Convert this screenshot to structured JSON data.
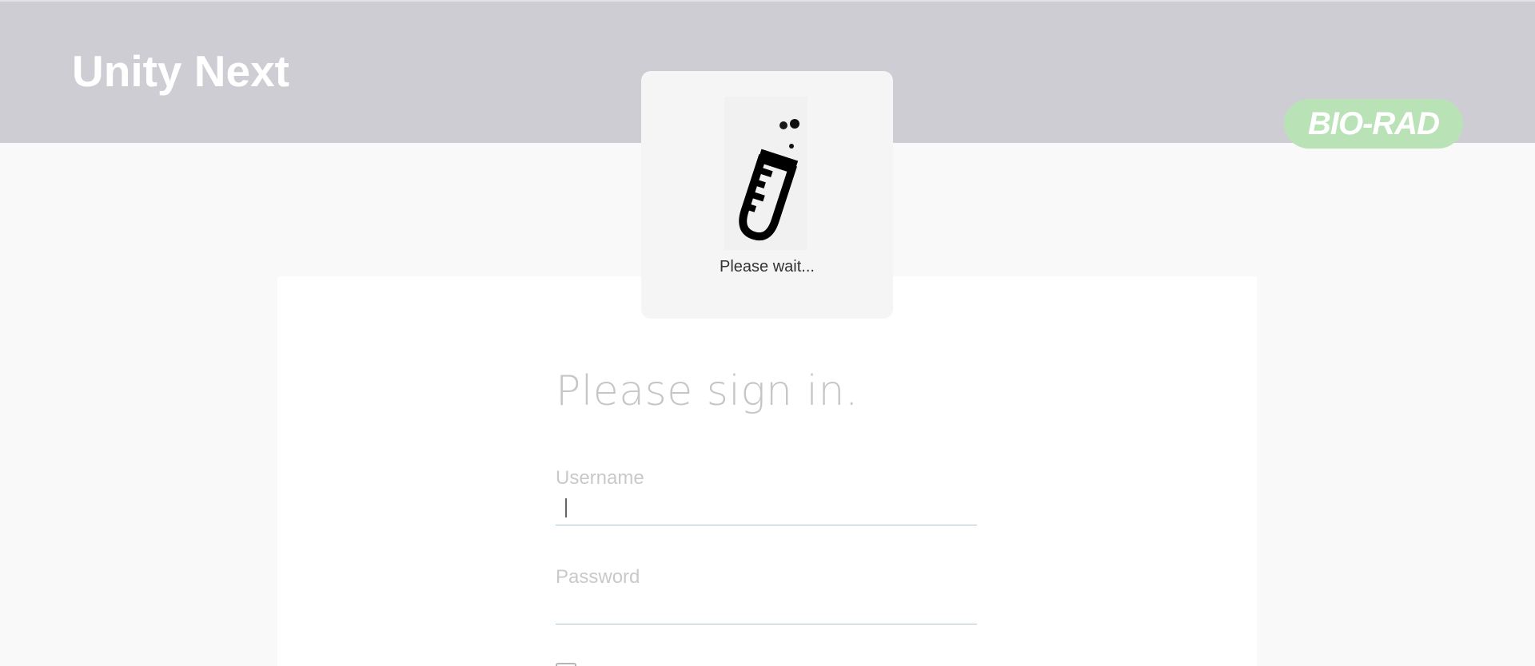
{
  "header": {
    "app_title": "Unity Next",
    "brand_logo_text": "BIO-RAD"
  },
  "loading": {
    "message": "Please wait..."
  },
  "signin": {
    "heading": "Please sign in.",
    "username_label": "Username",
    "username_value": "",
    "password_label": "Password",
    "password_value": ""
  },
  "colors": {
    "header_bg": "#cdcdd3",
    "brand_logo_bg": "#b9e3b6",
    "input_underline": "#a9c3d4"
  }
}
